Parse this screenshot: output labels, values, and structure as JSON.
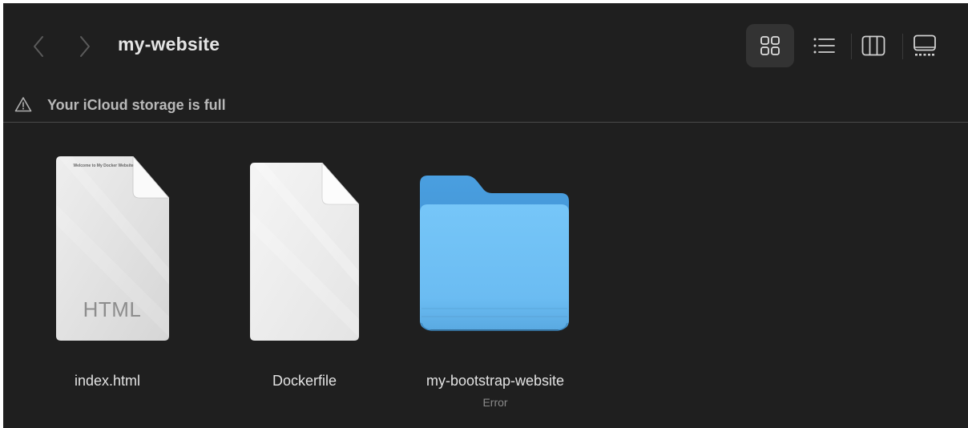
{
  "window": {
    "title": "my-website"
  },
  "toolbar": {
    "nav": [
      "back-chevron-icon",
      "forward-chevron-icon"
    ],
    "views": [
      {
        "name": "icons",
        "icon": "grid-icon",
        "active": true
      },
      {
        "name": "list",
        "icon": "list-icon",
        "active": false
      },
      {
        "name": "columns",
        "icon": "columns-icon",
        "active": false
      },
      {
        "name": "gallery",
        "icon": "gallery-icon",
        "active": false
      }
    ]
  },
  "banner": {
    "icon": "warning-icon",
    "text": "Your iCloud storage is full"
  },
  "files": [
    {
      "name": "index.html",
      "kind": "html-document-icon",
      "icon_label": "HTML",
      "preview_title": "Welcome to My Docker Website",
      "status": ""
    },
    {
      "name": "Dockerfile",
      "kind": "document-icon",
      "status": ""
    },
    {
      "name": "my-bootstrap-website",
      "kind": "folder-icon",
      "status": "Error"
    }
  ],
  "colors": {
    "window_bg": "#1f1f1f",
    "folder_blue": "#5ab4f0",
    "text_primary": "#e2e2e2",
    "text_secondary": "#8a8a8a"
  }
}
